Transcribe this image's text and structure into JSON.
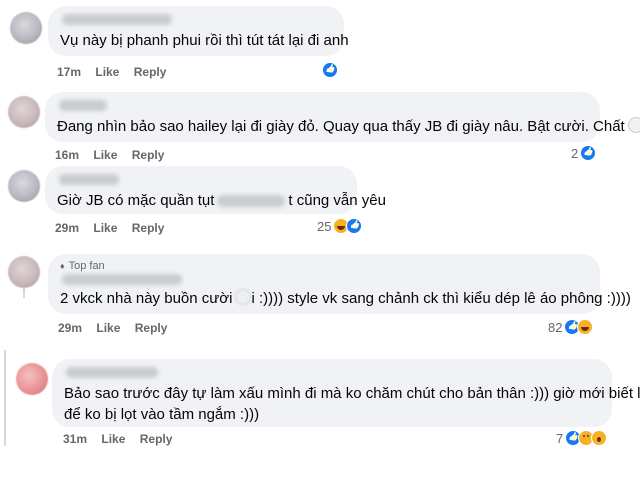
{
  "comments": [
    {
      "text": "Vụ này bị phanh phui rồi thì tút tát lại đi anh",
      "time": "17m",
      "like": "Like",
      "reply": "Reply",
      "reaction_count": "",
      "reactions": [
        "like"
      ]
    },
    {
      "text": "Đang nhìn bảo sao hailey lại đi giày đỏ. Quay qua thấy JB đi giày nâu. Bật cười. Chất",
      "time": "16m",
      "like": "Like",
      "reply": "Reply",
      "reaction_count": "2",
      "reactions": [
        "like"
      ]
    },
    {
      "text_before": "Giờ JB có mặc quần tụt",
      "text_after": "t cũng vẫn yêu",
      "time": "29m",
      "like": "Like",
      "reply": "Reply",
      "reaction_count": "25",
      "reactions": [
        "haha",
        "like"
      ]
    },
    {
      "badge": "Top fan",
      "text_before": "2 vkck nhà này buồn cười",
      "text_after": "i :)))) style vk sang chảnh ck thì kiểu dép lê áo phông :))))",
      "time": "29m",
      "like": "Like",
      "reply": "Reply",
      "reaction_count": "82",
      "reactions": [
        "like",
        "haha"
      ]
    },
    {
      "line1": "Bảo sao trước đây tự làm xấu mình đi mà ko chăm chút cho bản thân :))) giờ mới biết là",
      "line2": "để ko bị lọt vào tầm ngắm :)))",
      "time": "31m",
      "like": "Like",
      "reply": "Reply",
      "reaction_count": "7",
      "reactions": [
        "like",
        "sad",
        "wow"
      ]
    }
  ]
}
